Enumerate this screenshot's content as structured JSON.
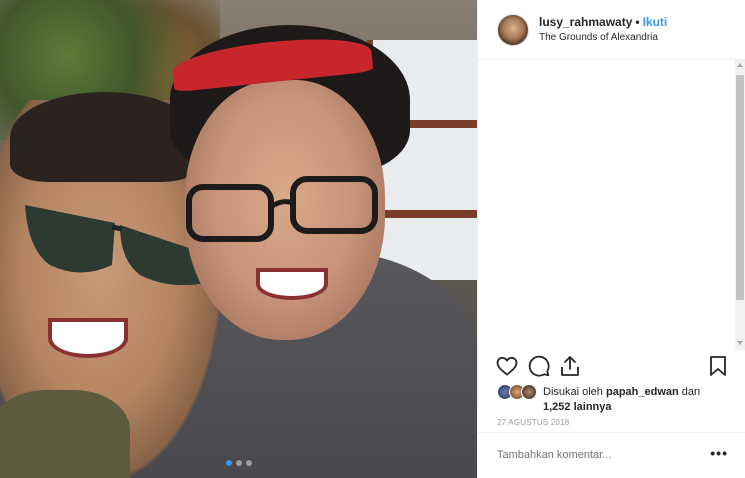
{
  "post": {
    "username": "lusy_rahmawaty",
    "separator": "•",
    "follow_label": "Ikuti",
    "location": "The Grounds of Alexandria"
  },
  "actions": {
    "like_icon": "heart-icon",
    "comment_icon": "comment-icon",
    "share_icon": "share-icon",
    "save_icon": "bookmark-icon"
  },
  "likes": {
    "prefix": "Disukai oleh",
    "user": "papah_edwan",
    "conjunction": "dan",
    "others": "1,252 lainnya"
  },
  "date": "27 AGUSTUS 2018",
  "comment": {
    "placeholder": "Tambahkan komentar...",
    "more_label": "•••"
  },
  "colors": {
    "accent": "#3897f0",
    "text": "#262626",
    "muted": "#999999"
  }
}
